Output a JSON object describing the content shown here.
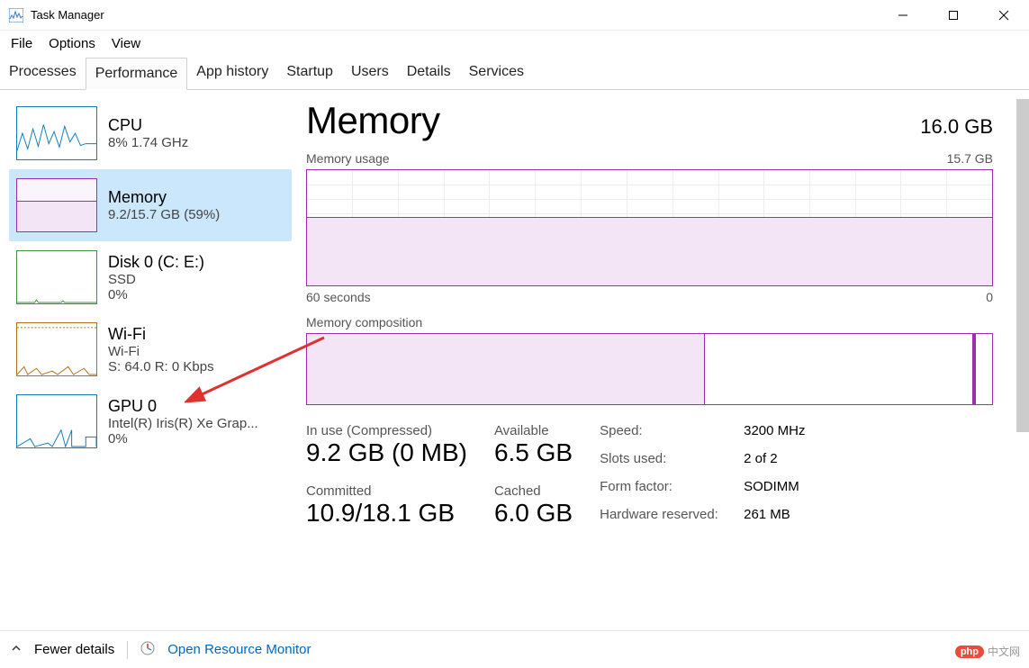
{
  "window": {
    "title": "Task Manager"
  },
  "menu": {
    "file": "File",
    "options": "Options",
    "view": "View"
  },
  "tabs": [
    "Processes",
    "Performance",
    "App history",
    "Startup",
    "Users",
    "Details",
    "Services"
  ],
  "active_tab": "Performance",
  "sidebar": [
    {
      "name": "CPU",
      "sub1": "8%  1.74 GHz",
      "sub2": "",
      "type": "cpu"
    },
    {
      "name": "Memory",
      "sub1": "9.2/15.7 GB (59%)",
      "sub2": "",
      "type": "mem",
      "selected": true
    },
    {
      "name": "Disk 0 (C: E:)",
      "sub1": "SSD",
      "sub2": "0%",
      "type": "disk"
    },
    {
      "name": "Wi-Fi",
      "sub1": "Wi-Fi",
      "sub2": "S: 64.0  R: 0 Kbps",
      "type": "wifi"
    },
    {
      "name": "GPU 0",
      "sub1": "Intel(R) Iris(R) Xe Grap...",
      "sub2": "0%",
      "type": "gpu"
    }
  ],
  "main": {
    "title": "Memory",
    "capacity": "16.0 GB",
    "usage_label": "Memory usage",
    "usage_max": "15.7 GB",
    "axis_left": "60 seconds",
    "axis_right": "0",
    "comp_label": "Memory composition",
    "stats": {
      "inuse_label": "In use (Compressed)",
      "inuse_val": "9.2 GB (0 MB)",
      "avail_label": "Available",
      "avail_val": "6.5 GB",
      "committed_label": "Committed",
      "committed_val": "10.9/18.1 GB",
      "cached_label": "Cached",
      "cached_val": "6.0 GB"
    },
    "kv": {
      "speed_k": "Speed:",
      "speed_v": "3200 MHz",
      "slots_k": "Slots used:",
      "slots_v": "2 of 2",
      "form_k": "Form factor:",
      "form_v": "SODIMM",
      "hw_k": "Hardware reserved:",
      "hw_v": "261 MB"
    }
  },
  "footer": {
    "fewer": "Fewer details",
    "rm": "Open Resource Monitor"
  },
  "chart_data": {
    "usage_chart": {
      "type": "area",
      "x_range_seconds": [
        60,
        0
      ],
      "y_range_gb": [
        0,
        15.7
      ],
      "current_gb": 9.2,
      "percent": 59,
      "title": "Memory usage"
    },
    "composition_chart": {
      "type": "bar",
      "segments": [
        {
          "name": "In use",
          "gb": 9.2
        },
        {
          "name": "Standby/Available",
          "gb": 6.5
        },
        {
          "name": "Hardware reserved",
          "gb": 0.3
        }
      ],
      "total_gb": 16.0
    },
    "cpu_sparkline": {
      "type": "line",
      "percent": 8
    },
    "memory_sparkline": {
      "type": "line",
      "percent": 59
    },
    "disk_sparkline": {
      "type": "line",
      "percent": 0
    },
    "wifi_sparkline": {
      "type": "line",
      "send_kbps": 64.0,
      "recv_kbps": 0
    },
    "gpu_sparkline": {
      "type": "line",
      "percent": 0
    }
  },
  "watermark": "中文网"
}
